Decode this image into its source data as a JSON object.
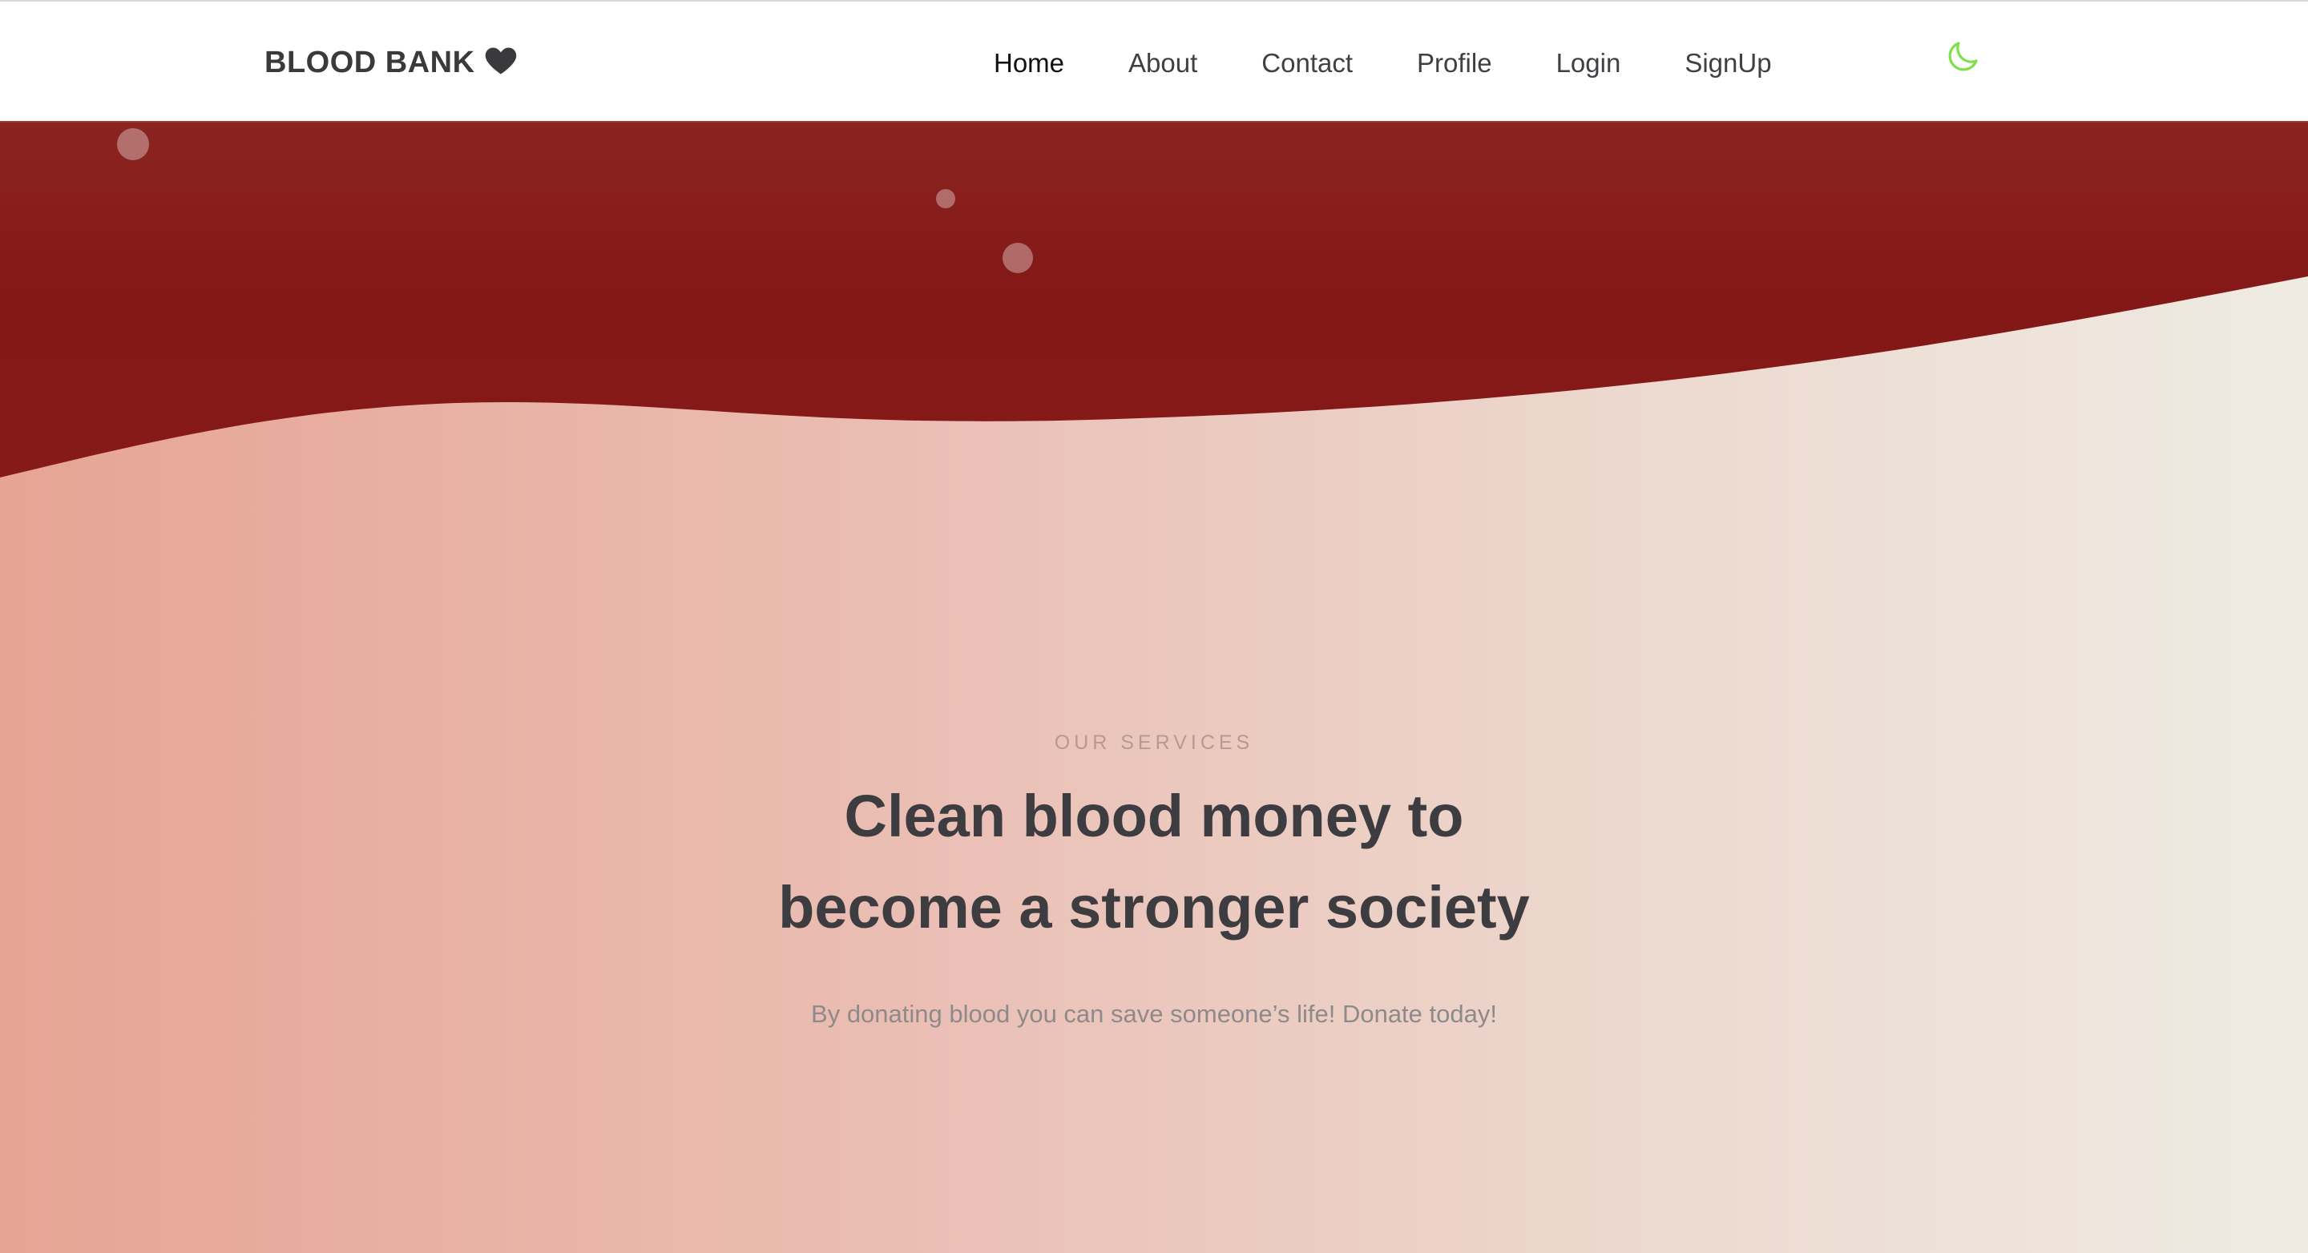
{
  "header": {
    "brand": "BLOOD BANK",
    "brand_icon": "heart-icon",
    "nav": [
      "Home",
      "About",
      "Contact",
      "Profile",
      "Login",
      "SignUp"
    ],
    "active": "Home",
    "theme_toggle_icon": "moon-icon"
  },
  "hero": {
    "eyebrow": "OUR SERVICES",
    "headline_line1": "Clean blood money to",
    "headline_line2": "become a stronger society",
    "tagline": "By donating blood you can save someone’s life! Donate today!"
  },
  "colors": {
    "wave": "#861a18",
    "text_dark": "#3d3c40",
    "eyebrow": "#b59a94",
    "moon": "#7ee04a"
  }
}
